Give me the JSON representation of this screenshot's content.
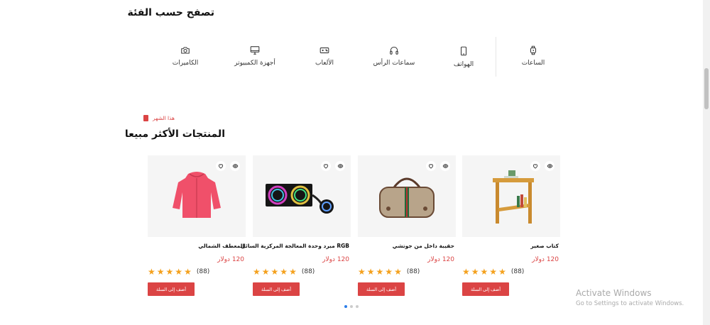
{
  "categories": {
    "title": "تصفح حسب الفئة",
    "items": [
      {
        "label": "الساعات",
        "icon": "watch-icon"
      },
      {
        "label": "الهواتف",
        "icon": "phone-icon"
      },
      {
        "label": "سماعات الرأس",
        "icon": "headphones-icon"
      },
      {
        "label": "الألعاب",
        "icon": "gamepad-icon"
      },
      {
        "label": "أجهزة الكمبيوتر",
        "icon": "monitor-icon"
      },
      {
        "label": "الكاميرات",
        "icon": "camera-icon"
      }
    ]
  },
  "best_selling": {
    "month_label": "هذا الشهر",
    "title": "المنتجات الأكثر مبيعا",
    "accent": "#db4444",
    "products": [
      {
        "name": "كتاب صغير",
        "price": "120 دولار",
        "rating_count": "(88)",
        "button": "أضف إلى السلة",
        "image": "side-table"
      },
      {
        "name": "حقيبة داخل من جوتشي",
        "price": "120 دولار",
        "rating_count": "(88)",
        "button": "أضف إلى السلة",
        "image": "gucci-bag"
      },
      {
        "name": "RGB مبرد وحدة المعالجة المركزية السائل",
        "price": "120 دولار",
        "rating_count": "(88)",
        "button": "أضف إلى السلة",
        "image": "rgb-cooler"
      },
      {
        "name": "المعطف الشمالي",
        "price": "120 دولار",
        "rating_count": "(88)",
        "button": "أضف إلى السلة",
        "image": "red-jacket"
      }
    ]
  },
  "watermark": {
    "line1": "Activate Windows",
    "line2": "Go to Settings to activate Windows."
  }
}
